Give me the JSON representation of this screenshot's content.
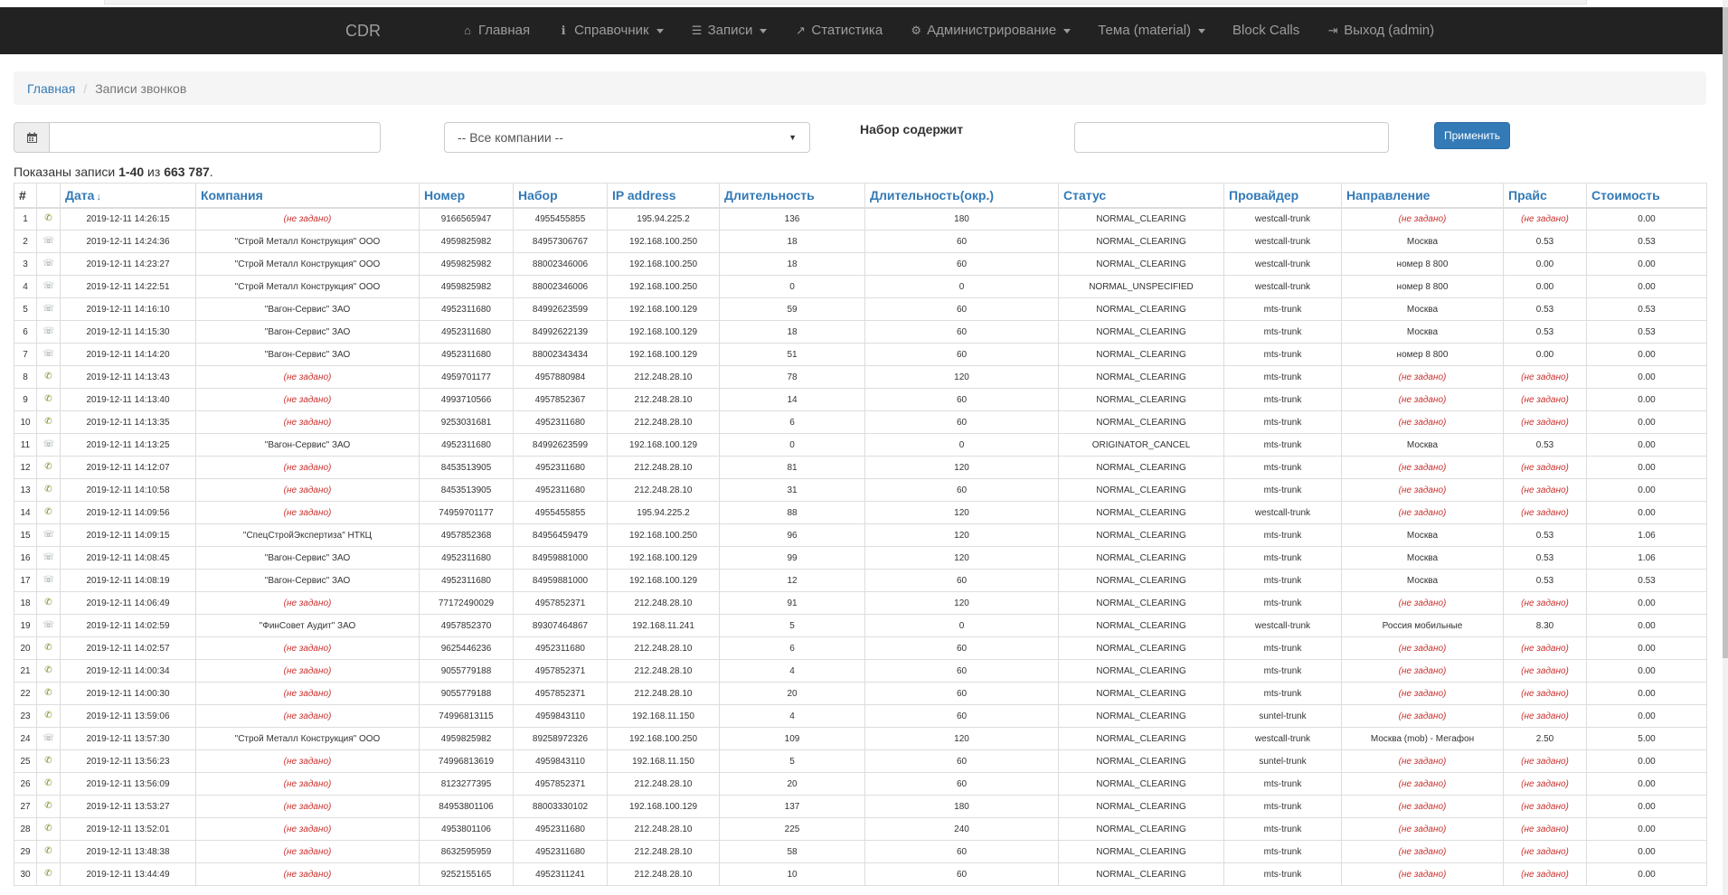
{
  "navbar": {
    "brand": "CDR",
    "items": [
      {
        "label": "Главная",
        "icon": "home-icon",
        "glyph": "⌂",
        "dropdown": false
      },
      {
        "label": "Справочник",
        "icon": "info-icon",
        "glyph": "ℹ",
        "dropdown": true
      },
      {
        "label": "Записи",
        "icon": "list-icon",
        "glyph": "☰",
        "dropdown": true
      },
      {
        "label": "Статистика",
        "icon": "chart-icon",
        "glyph": "↗",
        "dropdown": false
      },
      {
        "label": "Администрирование",
        "icon": "gear-icon",
        "glyph": "⚙",
        "dropdown": true
      },
      {
        "label": "Тема (material)",
        "icon": "",
        "glyph": "",
        "dropdown": true
      },
      {
        "label": "Block Calls",
        "icon": "",
        "glyph": "",
        "dropdown": false
      },
      {
        "label": "Выход (admin)",
        "icon": "logout-icon",
        "glyph": "⇥",
        "dropdown": false
      }
    ]
  },
  "breadcrumb": {
    "home": "Главная",
    "current": "Записи звонков"
  },
  "filters": {
    "date_value": "",
    "company_selected": "-- Все компании --",
    "dial_label": "Набор содержит",
    "dial_value": "",
    "apply_label": "Применить"
  },
  "summary": {
    "prefix": "Показаны записи ",
    "range": "1-40",
    "of": " из ",
    "total": "663 787",
    "suffix": "."
  },
  "table": {
    "headers": [
      "#",
      "",
      "Дата",
      "Компания",
      "Номер",
      "Набор",
      "IP address",
      "Длительность",
      "Длительность(окр.)",
      "Статус",
      "Провайдер",
      "Направление",
      "Прайс",
      "Стоимость"
    ],
    "rows": [
      {
        "n": "1",
        "dir": "in",
        "date": "2019-12-11 14:26:15",
        "company": "(не задано)",
        "number": "9166565947",
        "dial": "4955455855",
        "ip": "195.94.225.2",
        "dur": "136",
        "durr": "180",
        "status": "NORMAL_CLEARING",
        "provider": "westcall-trunk",
        "direction": "(не задано)",
        "price": "(не задано)",
        "cost": "0.00"
      },
      {
        "n": "2",
        "dir": "out",
        "date": "2019-12-11 14:24:36",
        "company": "\"Строй Металл Конструкция\" ООО",
        "number": "4959825982",
        "dial": "84957306767",
        "ip": "192.168.100.250",
        "dur": "18",
        "durr": "60",
        "status": "NORMAL_CLEARING",
        "provider": "westcall-trunk",
        "direction": "Москва",
        "price": "0.53",
        "cost": "0.53"
      },
      {
        "n": "3",
        "dir": "out",
        "date": "2019-12-11 14:23:27",
        "company": "\"Строй Металл Конструкция\" ООО",
        "number": "4959825982",
        "dial": "88002346006",
        "ip": "192.168.100.250",
        "dur": "18",
        "durr": "60",
        "status": "NORMAL_CLEARING",
        "provider": "westcall-trunk",
        "direction": "номер 8 800",
        "price": "0.00",
        "cost": "0.00"
      },
      {
        "n": "4",
        "dir": "out",
        "date": "2019-12-11 14:22:51",
        "company": "\"Строй Металл Конструкция\" ООО",
        "number": "4959825982",
        "dial": "88002346006",
        "ip": "192.168.100.250",
        "dur": "0",
        "durr": "0",
        "status": "NORMAL_UNSPECIFIED",
        "provider": "westcall-trunk",
        "direction": "номер 8 800",
        "price": "0.00",
        "cost": "0.00"
      },
      {
        "n": "5",
        "dir": "out",
        "date": "2019-12-11 14:16:10",
        "company": "\"Вагон-Сервис\" ЗАО",
        "number": "4952311680",
        "dial": "84992623599",
        "ip": "192.168.100.129",
        "dur": "59",
        "durr": "60",
        "status": "NORMAL_CLEARING",
        "provider": "mts-trunk",
        "direction": "Москва",
        "price": "0.53",
        "cost": "0.53"
      },
      {
        "n": "6",
        "dir": "out",
        "date": "2019-12-11 14:15:30",
        "company": "\"Вагон-Сервис\" ЗАО",
        "number": "4952311680",
        "dial": "84992622139",
        "ip": "192.168.100.129",
        "dur": "18",
        "durr": "60",
        "status": "NORMAL_CLEARING",
        "provider": "mts-trunk",
        "direction": "Москва",
        "price": "0.53",
        "cost": "0.53"
      },
      {
        "n": "7",
        "dir": "out",
        "date": "2019-12-11 14:14:20",
        "company": "\"Вагон-Сервис\" ЗАО",
        "number": "4952311680",
        "dial": "88002343434",
        "ip": "192.168.100.129",
        "dur": "51",
        "durr": "60",
        "status": "NORMAL_CLEARING",
        "provider": "mts-trunk",
        "direction": "номер 8 800",
        "price": "0.00",
        "cost": "0.00"
      },
      {
        "n": "8",
        "dir": "in",
        "date": "2019-12-11 14:13:43",
        "company": "(не задано)",
        "number": "4959701177",
        "dial": "4957880984",
        "ip": "212.248.28.10",
        "dur": "78",
        "durr": "120",
        "status": "NORMAL_CLEARING",
        "provider": "mts-trunk",
        "direction": "(не задано)",
        "price": "(не задано)",
        "cost": "0.00"
      },
      {
        "n": "9",
        "dir": "in",
        "date": "2019-12-11 14:13:40",
        "company": "(не задано)",
        "number": "4993710566",
        "dial": "4957852367",
        "ip": "212.248.28.10",
        "dur": "14",
        "durr": "60",
        "status": "NORMAL_CLEARING",
        "provider": "mts-trunk",
        "direction": "(не задано)",
        "price": "(не задано)",
        "cost": "0.00"
      },
      {
        "n": "10",
        "dir": "in",
        "date": "2019-12-11 14:13:35",
        "company": "(не задано)",
        "number": "9253031681",
        "dial": "4952311680",
        "ip": "212.248.28.10",
        "dur": "6",
        "durr": "60",
        "status": "NORMAL_CLEARING",
        "provider": "mts-trunk",
        "direction": "(не задано)",
        "price": "(не задано)",
        "cost": "0.00"
      },
      {
        "n": "11",
        "dir": "out",
        "date": "2019-12-11 14:13:25",
        "company": "\"Вагон-Сервис\" ЗАО",
        "number": "4952311680",
        "dial": "84992623599",
        "ip": "192.168.100.129",
        "dur": "0",
        "durr": "0",
        "status": "ORIGINATOR_CANCEL",
        "provider": "mts-trunk",
        "direction": "Москва",
        "price": "0.53",
        "cost": "0.00"
      },
      {
        "n": "12",
        "dir": "in",
        "date": "2019-12-11 14:12:07",
        "company": "(не задано)",
        "number": "8453513905",
        "dial": "4952311680",
        "ip": "212.248.28.10",
        "dur": "81",
        "durr": "120",
        "status": "NORMAL_CLEARING",
        "provider": "mts-trunk",
        "direction": "(не задано)",
        "price": "(не задано)",
        "cost": "0.00"
      },
      {
        "n": "13",
        "dir": "in",
        "date": "2019-12-11 14:10:58",
        "company": "(не задано)",
        "number": "8453513905",
        "dial": "4952311680",
        "ip": "212.248.28.10",
        "dur": "31",
        "durr": "60",
        "status": "NORMAL_CLEARING",
        "provider": "mts-trunk",
        "direction": "(не задано)",
        "price": "(не задано)",
        "cost": "0.00"
      },
      {
        "n": "14",
        "dir": "in",
        "date": "2019-12-11 14:09:56",
        "company": "(не задано)",
        "number": "74959701177",
        "dial": "4955455855",
        "ip": "195.94.225.2",
        "dur": "88",
        "durr": "120",
        "status": "NORMAL_CLEARING",
        "provider": "westcall-trunk",
        "direction": "(не задано)",
        "price": "(не задано)",
        "cost": "0.00"
      },
      {
        "n": "15",
        "dir": "out",
        "date": "2019-12-11 14:09:15",
        "company": "\"СпецСтройЭкспертиза\" НТКЦ",
        "number": "4957852368",
        "dial": "84956459479",
        "ip": "192.168.100.250",
        "dur": "96",
        "durr": "120",
        "status": "NORMAL_CLEARING",
        "provider": "mts-trunk",
        "direction": "Москва",
        "price": "0.53",
        "cost": "1.06"
      },
      {
        "n": "16",
        "dir": "out",
        "date": "2019-12-11 14:08:45",
        "company": "\"Вагон-Сервис\" ЗАО",
        "number": "4952311680",
        "dial": "84959881000",
        "ip": "192.168.100.129",
        "dur": "99",
        "durr": "120",
        "status": "NORMAL_CLEARING",
        "provider": "mts-trunk",
        "direction": "Москва",
        "price": "0.53",
        "cost": "1.06"
      },
      {
        "n": "17",
        "dir": "out",
        "date": "2019-12-11 14:08:19",
        "company": "\"Вагон-Сервис\" ЗАО",
        "number": "4952311680",
        "dial": "84959881000",
        "ip": "192.168.100.129",
        "dur": "12",
        "durr": "60",
        "status": "NORMAL_CLEARING",
        "provider": "mts-trunk",
        "direction": "Москва",
        "price": "0.53",
        "cost": "0.53"
      },
      {
        "n": "18",
        "dir": "in",
        "date": "2019-12-11 14:06:49",
        "company": "(не задано)",
        "number": "77172490029",
        "dial": "4957852371",
        "ip": "212.248.28.10",
        "dur": "91",
        "durr": "120",
        "status": "NORMAL_CLEARING",
        "provider": "mts-trunk",
        "direction": "(не задано)",
        "price": "(не задано)",
        "cost": "0.00"
      },
      {
        "n": "19",
        "dir": "out",
        "date": "2019-12-11 14:02:59",
        "company": "\"ФинСовет Аудит\" ЗАО",
        "number": "4957852370",
        "dial": "89307464867",
        "ip": "192.168.11.241",
        "dur": "5",
        "durr": "0",
        "status": "NORMAL_CLEARING",
        "provider": "westcall-trunk",
        "direction": "Россия мобильные",
        "price": "8.30",
        "cost": "0.00"
      },
      {
        "n": "20",
        "dir": "in",
        "date": "2019-12-11 14:02:57",
        "company": "(не задано)",
        "number": "9625446236",
        "dial": "4952311680",
        "ip": "212.248.28.10",
        "dur": "6",
        "durr": "60",
        "status": "NORMAL_CLEARING",
        "provider": "mts-trunk",
        "direction": "(не задано)",
        "price": "(не задано)",
        "cost": "0.00"
      },
      {
        "n": "21",
        "dir": "in",
        "date": "2019-12-11 14:00:34",
        "company": "(не задано)",
        "number": "9055779188",
        "dial": "4957852371",
        "ip": "212.248.28.10",
        "dur": "4",
        "durr": "60",
        "status": "NORMAL_CLEARING",
        "provider": "mts-trunk",
        "direction": "(не задано)",
        "price": "(не задано)",
        "cost": "0.00"
      },
      {
        "n": "22",
        "dir": "in",
        "date": "2019-12-11 14:00:30",
        "company": "(не задано)",
        "number": "9055779188",
        "dial": "4957852371",
        "ip": "212.248.28.10",
        "dur": "20",
        "durr": "60",
        "status": "NORMAL_CLEARING",
        "provider": "mts-trunk",
        "direction": "(не задано)",
        "price": "(не задано)",
        "cost": "0.00"
      },
      {
        "n": "23",
        "dir": "in",
        "date": "2019-12-11 13:59:06",
        "company": "(не задано)",
        "number": "74996813115",
        "dial": "4959843110",
        "ip": "192.168.11.150",
        "dur": "4",
        "durr": "60",
        "status": "NORMAL_CLEARING",
        "provider": "suntel-trunk",
        "direction": "(не задано)",
        "price": "(не задано)",
        "cost": "0.00"
      },
      {
        "n": "24",
        "dir": "out",
        "date": "2019-12-11 13:57:30",
        "company": "\"Строй Металл Конструкция\" ООО",
        "number": "4959825982",
        "dial": "89258972326",
        "ip": "192.168.100.250",
        "dur": "109",
        "durr": "120",
        "status": "NORMAL_CLEARING",
        "provider": "westcall-trunk",
        "direction": "Москва (mob) - Мегафон",
        "price": "2.50",
        "cost": "5.00"
      },
      {
        "n": "25",
        "dir": "in",
        "date": "2019-12-11 13:56:23",
        "company": "(не задано)",
        "number": "74996813619",
        "dial": "4959843110",
        "ip": "192.168.11.150",
        "dur": "5",
        "durr": "60",
        "status": "NORMAL_CLEARING",
        "provider": "suntel-trunk",
        "direction": "(не задано)",
        "price": "(не задано)",
        "cost": "0.00"
      },
      {
        "n": "26",
        "dir": "in",
        "date": "2019-12-11 13:56:09",
        "company": "(не задано)",
        "number": "8123277395",
        "dial": "4957852371",
        "ip": "212.248.28.10",
        "dur": "20",
        "durr": "60",
        "status": "NORMAL_CLEARING",
        "provider": "mts-trunk",
        "direction": "(не задано)",
        "price": "(не задано)",
        "cost": "0.00"
      },
      {
        "n": "27",
        "dir": "in",
        "date": "2019-12-11 13:53:27",
        "company": "(не задано)",
        "number": "84953801106",
        "dial": "88003330102",
        "ip": "192.168.100.129",
        "dur": "137",
        "durr": "180",
        "status": "NORMAL_CLEARING",
        "provider": "mts-trunk",
        "direction": "(не задано)",
        "price": "(не задано)",
        "cost": "0.00"
      },
      {
        "n": "28",
        "dir": "in",
        "date": "2019-12-11 13:52:01",
        "company": "(не задано)",
        "number": "4953801106",
        "dial": "4952311680",
        "ip": "212.248.28.10",
        "dur": "225",
        "durr": "240",
        "status": "NORMAL_CLEARING",
        "provider": "mts-trunk",
        "direction": "(не задано)",
        "price": "(не задано)",
        "cost": "0.00"
      },
      {
        "n": "29",
        "dir": "in",
        "date": "2019-12-11 13:48:38",
        "company": "(не задано)",
        "number": "8632595959",
        "dial": "4952311680",
        "ip": "212.248.28.10",
        "dur": "58",
        "durr": "60",
        "status": "NORMAL_CLEARING",
        "provider": "mts-trunk",
        "direction": "(не задано)",
        "price": "(не задано)",
        "cost": "0.00"
      },
      {
        "n": "30",
        "dir": "in",
        "date": "2019-12-11 13:44:49",
        "company": "(не задано)",
        "number": "9252155165",
        "dial": "4952311241",
        "ip": "212.248.28.10",
        "dur": "10",
        "durr": "60",
        "status": "NORMAL_CLEARING",
        "provider": "mts-trunk",
        "direction": "(не задано)",
        "price": "(не задано)",
        "cost": "0.00"
      }
    ]
  }
}
